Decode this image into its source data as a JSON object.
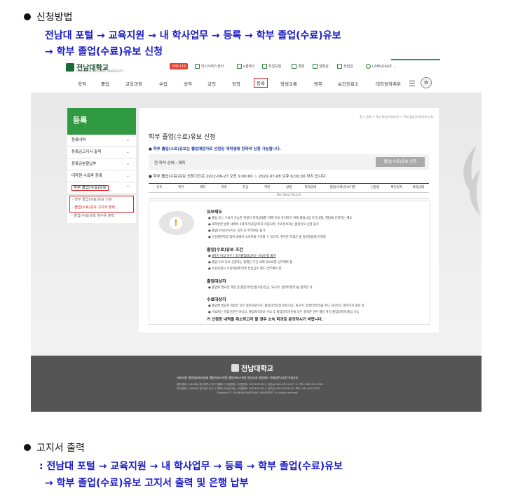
{
  "section1": {
    "title": "신청방법",
    "path_line1": "전남대 포털 → 교육지원 → 내 학사업무 → 등록 → 학부 졸업(수료)유보",
    "path_line2": "→ 학부 졸업(수료)유보 신청"
  },
  "section2": {
    "title": "고지서 출력",
    "path_line1": ": 전남대 포털 → 교육지원 → 내 학사업무 → 등록 → 학부 졸업(수료)유보",
    "path_line2": "→ 학부 졸업(수료)유보 고지서 출력 및 은행 납부"
  },
  "screenshot": {
    "logo": "전남대학교",
    "logo_sub": "CHONNAM NATIONAL UNIVERSITY",
    "util_badge": "코로나19",
    "util_links": [
      "학사서비스센터",
      "e클래스",
      "취업포털",
      "경영",
      "생활관",
      "생협관",
      "LANGUAGE"
    ],
    "menu": [
      "학적",
      "졸업",
      "교육과정",
      "수업",
      "성적",
      "교직",
      "장학",
      "등록",
      "학생교류",
      "병무",
      "보건진료소",
      "대학원자계부"
    ],
    "menu_emblem": "✿",
    "sidebar": {
      "header": "등록",
      "items": [
        "등록내역",
        "등록금고지서 출력",
        "등록금분할납부",
        "대학원 수료후 등록"
      ],
      "selected": "학부 졸업(수료)유보",
      "subitems": [
        "학부 졸업(수료)유보 신청",
        "졸업(수료)유보 고지서 출력"
      ],
      "subitem_extra": "졸업(수료)유보 영수증 출력"
    },
    "breadcrumb": "홈 > 등록 > 학부 졸업(수료)유보 > 학부 졸업(수료)유보 신청",
    "main_title": "학부 졸업(수료)유보 신청",
    "notice_prefix": "학부 졸업(수료)유보는 졸업예정자로 선정된 재학생에 한하여 신청 가능합니다.",
    "status_label": "현 학적 상태 : 재학",
    "status_button": "졸업(수료)유보 신청 ",
    "period_text": "학부 졸업(수료)유보 신청기간은 2022-06-27 오전 9:00:00 ~ 2022-07-08 오후 6:00:30 까지 입니다.",
    "table_headers": [
      "년도",
      "학기",
      "대학",
      "학과",
      "전공",
      "학번",
      "성명",
      "학적상태",
      "졸업(수료)유보기준",
      "신청일",
      "확인일자",
      "처리상태"
    ],
    "table_empty": "No Data Found",
    "info": {
      "sec1": "유보제도",
      "sec1_items": [
        "졸업 또는 수료가 가능한 학생이 학적상태를 '재학'으로 유지하기 위해 졸업시험 기간(1월, 7월)에 신청하는 제도",
        "재학연한 범위 내에서 4개학기(휴강)까지 허용되며, 수료유보자는 졸업유보 신청 불가",
        "졸업(수료)유보자는 휴학 등 학적변동 불가",
        "수강제한학점 범위 내에서 교과목을 수강할 수 있으며, 취득한 학점은 총 평균평점에 반영됨"
      ],
      "sec2": "졸업(수료)유보 조건",
      "sec2_items": [
        "8학기 이상 이수 / 조기졸업대상자는 유보신청 불가",
        "졸업·수료 유보 신청자는 정해진 기간 내에 유보비를 납부해야 함",
        "수강신청시 수강학점에 따른 납임금은 별도 납부해야 함"
      ],
      "sec3": "졸업대상자",
      "sec3_items": [
        "졸업에 필요한 학점 및 졸업자격인정기준(전공, 외국어, 컴퓨터영역)을 충족한 자"
      ],
      "sec4": "수료대상자",
      "sec4_items": [
        "졸업에 필요한 학점은 모두 충족하였으나, 졸업자격인정기준(전공, 외국어, 컴퓨터영역)을 아니 하나라도 충족하지 못한 자",
        "수료자는 학점신분은 아니고, 졸업자격자로 수료 후 졸업자격기준을 모두 충족한 경우 해당 학기 졸업일자에 졸업 가능"
      ],
      "final": "기 신청한 내역을 취소하고자 할 경우 소속 학과로 문의하시기 바랍니다."
    },
    "footer": {
      "logo": "전남대학교",
      "links": "서비스맵   개인정보처리방침   행정서비스헌장   행정서비스헌장   정보공개   청렴센터   이메일주소무단수집거부",
      "line1": "광주캠퍼스 (61186) 광주광역시 북구 용봉로 77(용봉동) / 대표전화: 062-530-5114, 야간실: 062-530-1187~8 / 팩스: 062-530-1189",
      "line2": "여수캠퍼스 (59626) 전라남도 여수시 대학로 50(둔덕동) / 대표전화: 062-659-6114, 당직실: 062-659-6111 / 팩스: 061-659-7055",
      "line3": "Copyright © CHONNAM NATIONAL UNIVERSITY. All rights reserved."
    }
  }
}
